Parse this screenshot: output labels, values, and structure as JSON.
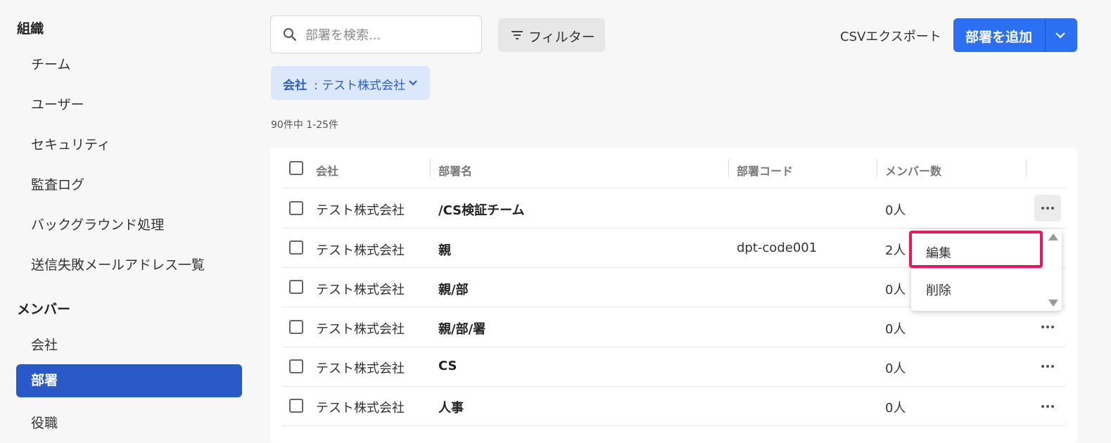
{
  "sidebar": {
    "org_heading": "組織",
    "org_items": [
      "チーム",
      "ユーザー",
      "セキュリティ",
      "監査ログ",
      "バックグラウンド処理",
      "送信失敗メールアドレス一覧"
    ],
    "member_heading": "メンバー",
    "member_items": [
      "会社",
      "部署",
      "役職"
    ],
    "active_item": "部署"
  },
  "toolbar": {
    "search_placeholder": "部署を検索...",
    "filter_label": "フィルター",
    "csv_label": "CSVエクスポート",
    "add_label": "部署を追加"
  },
  "filter_chip": {
    "key": "会社",
    "value": ": テスト株式会社"
  },
  "result_count": "90件中 1-25件",
  "table": {
    "headers": [
      "会社",
      "部署名",
      "部署コード",
      "メンバー数"
    ],
    "rows": [
      {
        "company": "テスト株式会社",
        "name": "/CS検証チーム",
        "code": "",
        "members": "0人"
      },
      {
        "company": "テスト株式会社",
        "name": "親",
        "code": "dpt-code001",
        "members": "2人"
      },
      {
        "company": "テスト株式会社",
        "name": "親/部",
        "code": "",
        "members": "0人"
      },
      {
        "company": "テスト株式会社",
        "name": "親/部/署",
        "code": "",
        "members": "0人"
      },
      {
        "company": "テスト株式会社",
        "name": "CS",
        "code": "",
        "members": "0人"
      },
      {
        "company": "テスト株式会社",
        "name": "人事",
        "code": "",
        "members": "0人"
      }
    ]
  },
  "row_menu": {
    "edit": "編集",
    "delete": "削除"
  },
  "colors": {
    "primary": "#2b6ff2",
    "active_nav": "#2959c7",
    "chip_bg": "#dbe7fb",
    "highlight": "#f0145a"
  }
}
